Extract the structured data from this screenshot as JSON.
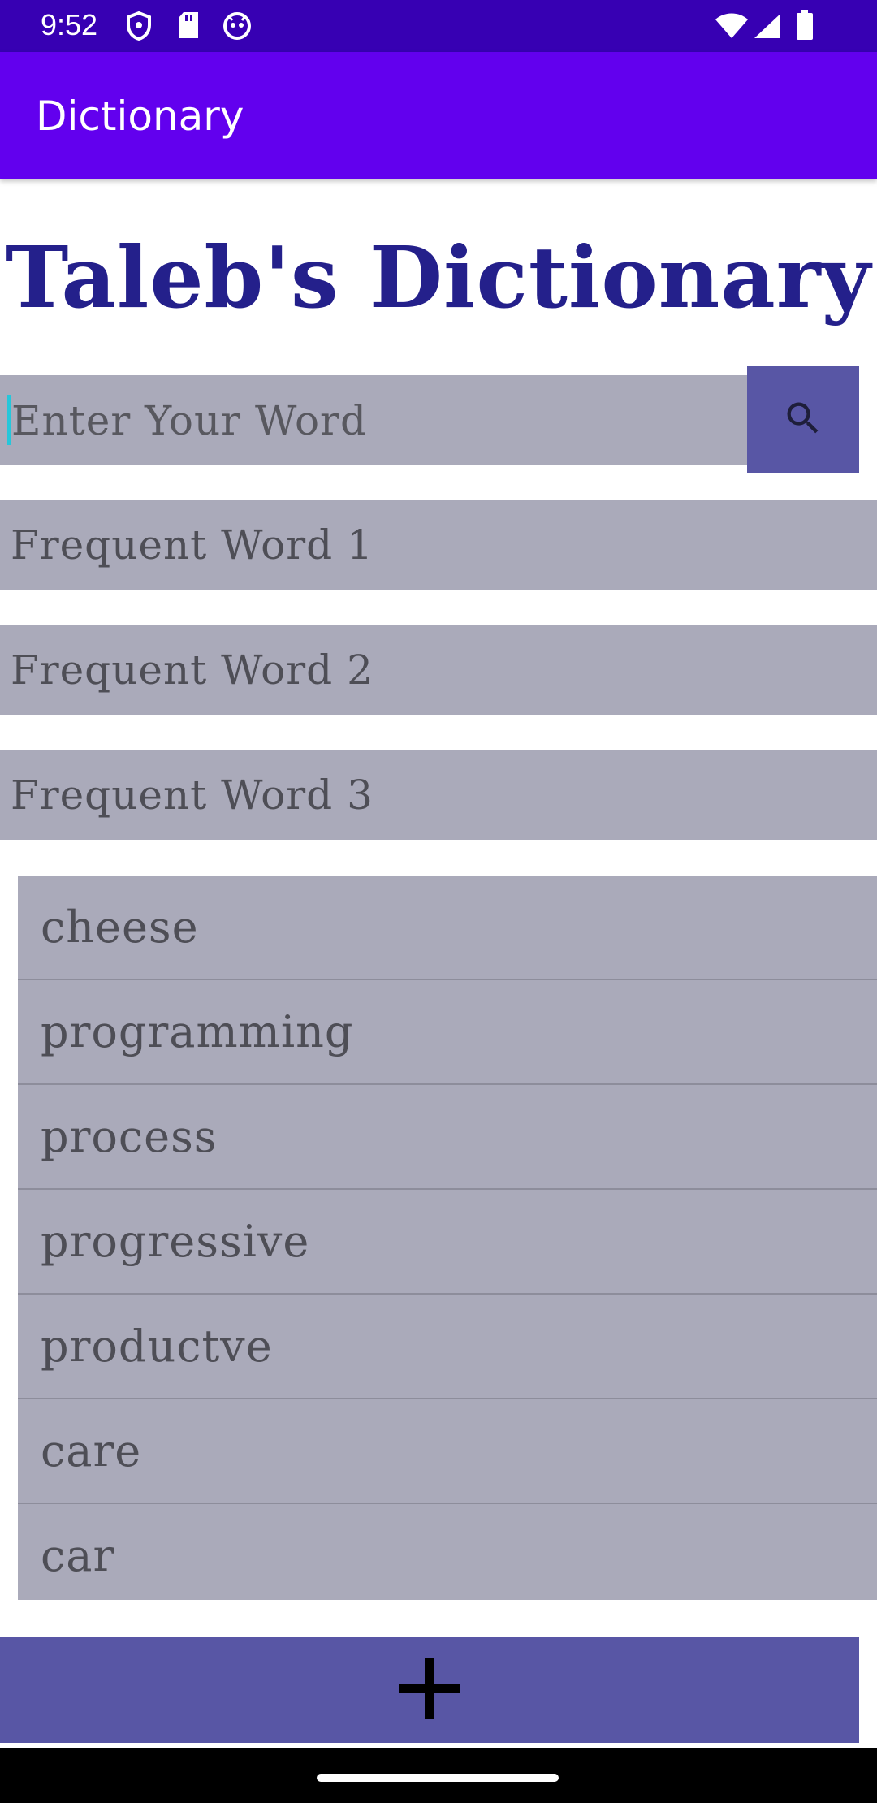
{
  "status_bar": {
    "time": "9:52",
    "icons": [
      "shield-icon",
      "sd-card-icon",
      "android-debug-icon",
      "wifi-icon",
      "cell-signal-icon",
      "battery-icon"
    ],
    "color": "#3700b3"
  },
  "app_bar": {
    "title": "Dictionary",
    "color": "#6200ee"
  },
  "main": {
    "heading": "Taleb's Dictionary",
    "heading_color": "#24208b",
    "search": {
      "placeholder": "Enter Your Word",
      "value": "",
      "button_icon": "search-icon"
    },
    "frequent_words": [
      "Frequent Word 1",
      "Frequent Word 2",
      "Frequent Word 3"
    ],
    "word_list": [
      "cheese",
      "programming",
      "process",
      "progressive",
      "productve",
      "care",
      "car"
    ],
    "add_button_icon": "plus-icon",
    "accent_color": "#5856a5",
    "field_color": "#aaaaba"
  }
}
